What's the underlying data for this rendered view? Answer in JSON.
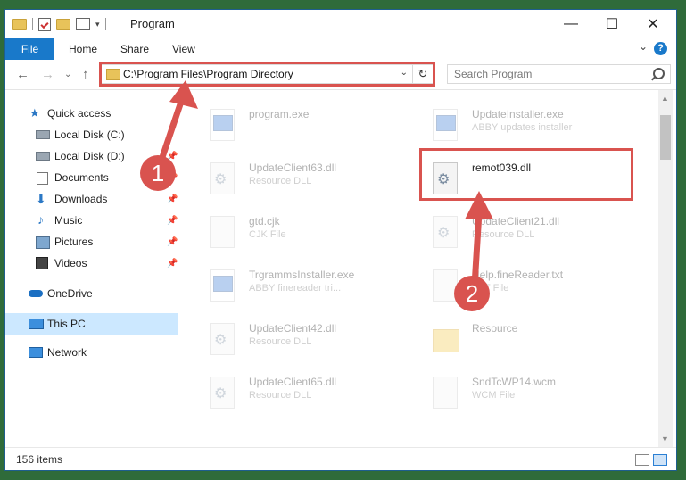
{
  "window": {
    "title": "Program",
    "min_glyph": "—",
    "max_glyph": "☐",
    "close_glyph": "✕"
  },
  "ribbon": {
    "tabs": [
      "File",
      "Home",
      "Share",
      "View"
    ],
    "help_glyph": "?",
    "expand_glyph": "⌄"
  },
  "nav": {
    "back_glyph": "←",
    "forward_glyph": "→",
    "recent_glyph": "⌄",
    "up_glyph": "↑",
    "address_path": "C:\\Program Files\\Program Directory",
    "address_dropdown_glyph": "⌄",
    "refresh_glyph": "↻",
    "search_placeholder": "Search Program"
  },
  "sidebar": {
    "items": [
      {
        "label": "Quick access",
        "icon": "star-icon",
        "pinned": false
      },
      {
        "label": "Local Disk (C:)",
        "icon": "drive-icon",
        "pinned": false
      },
      {
        "label": "Local Disk (D:)",
        "icon": "drive-icon",
        "pinned": true
      },
      {
        "label": "Documents",
        "icon": "documents-icon",
        "pinned": true
      },
      {
        "label": "Downloads",
        "icon": "download-icon",
        "pinned": true
      },
      {
        "label": "Music",
        "icon": "music-icon",
        "pinned": true
      },
      {
        "label": "Pictures",
        "icon": "pictures-icon",
        "pinned": true
      },
      {
        "label": "Videos",
        "icon": "videos-icon",
        "pinned": true
      },
      {
        "label": "OneDrive",
        "icon": "cloud-icon",
        "pinned": false
      },
      {
        "label": "This PC",
        "icon": "computer-icon",
        "pinned": false,
        "selected": true
      },
      {
        "label": "Network",
        "icon": "network-icon",
        "pinned": false
      }
    ],
    "pin_glyph": "📌"
  },
  "files": [
    {
      "name": "program.exe",
      "type": "",
      "icon": "exe-icon"
    },
    {
      "name": "UpdateInstaller.exe",
      "type": "ABBY updates installer",
      "icon": "exe-icon"
    },
    {
      "name": "UpdateClient63.dll",
      "type": "Resource DLL",
      "icon": "dll-icon"
    },
    {
      "name": "remot039.dll",
      "type": "",
      "icon": "dll-icon",
      "highlighted": true
    },
    {
      "name": "gtd.cjk",
      "type": "CJK File",
      "icon": "file-icon"
    },
    {
      "name": "UpdateClient21.dll",
      "type": "Resource DLL",
      "icon": "dll-icon"
    },
    {
      "name": "TrgrammsInstaller.exe",
      "type": "ABBY finereader tri...",
      "icon": "exe-icon"
    },
    {
      "name": "Help.fineReader.txt",
      "type": "TXT File",
      "icon": "file-icon"
    },
    {
      "name": "UpdateClient42.dll",
      "type": "Resource DLL",
      "icon": "dll-icon"
    },
    {
      "name": "Resource",
      "type": "",
      "icon": "folder-icon"
    },
    {
      "name": "UpdateClient65.dll",
      "type": "Resource DLL",
      "icon": "dll-icon"
    },
    {
      "name": "SndTcWP14.wcm",
      "type": "WCM File",
      "icon": "file-icon"
    }
  ],
  "status": {
    "item_count": "156 items"
  },
  "annotations": {
    "step1": "1",
    "step2": "2",
    "color": "#d9534f"
  }
}
